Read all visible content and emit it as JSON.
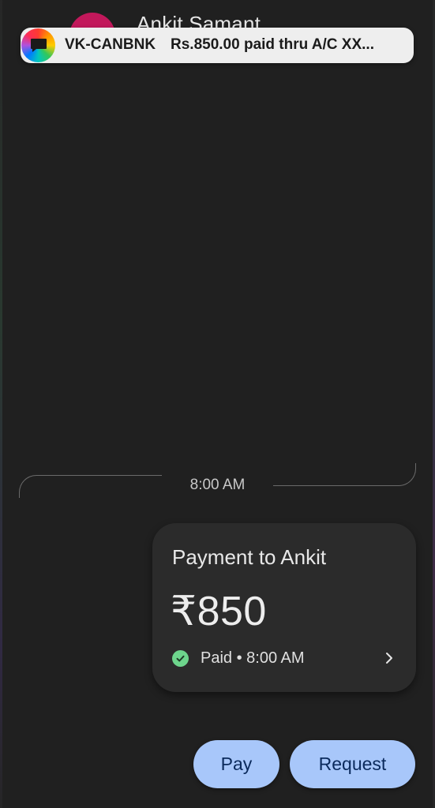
{
  "header": {
    "contact_name": "Ankit Samant"
  },
  "notification": {
    "icon": "messages-app-icon",
    "sender": "VK-CANBNK",
    "message": "Rs.850.00 paid thru A/C XX..."
  },
  "conversation": {
    "time_separator": "8:00 AM",
    "payment_card": {
      "title": "Payment to Ankit",
      "amount": "₹850",
      "status": "Paid • 8:00 AM",
      "status_icon": "check-circle-icon",
      "status_color": "#6dd58c"
    }
  },
  "actions": {
    "pay_label": "Pay",
    "request_label": "Request",
    "button_color": "#a8c7fa"
  }
}
